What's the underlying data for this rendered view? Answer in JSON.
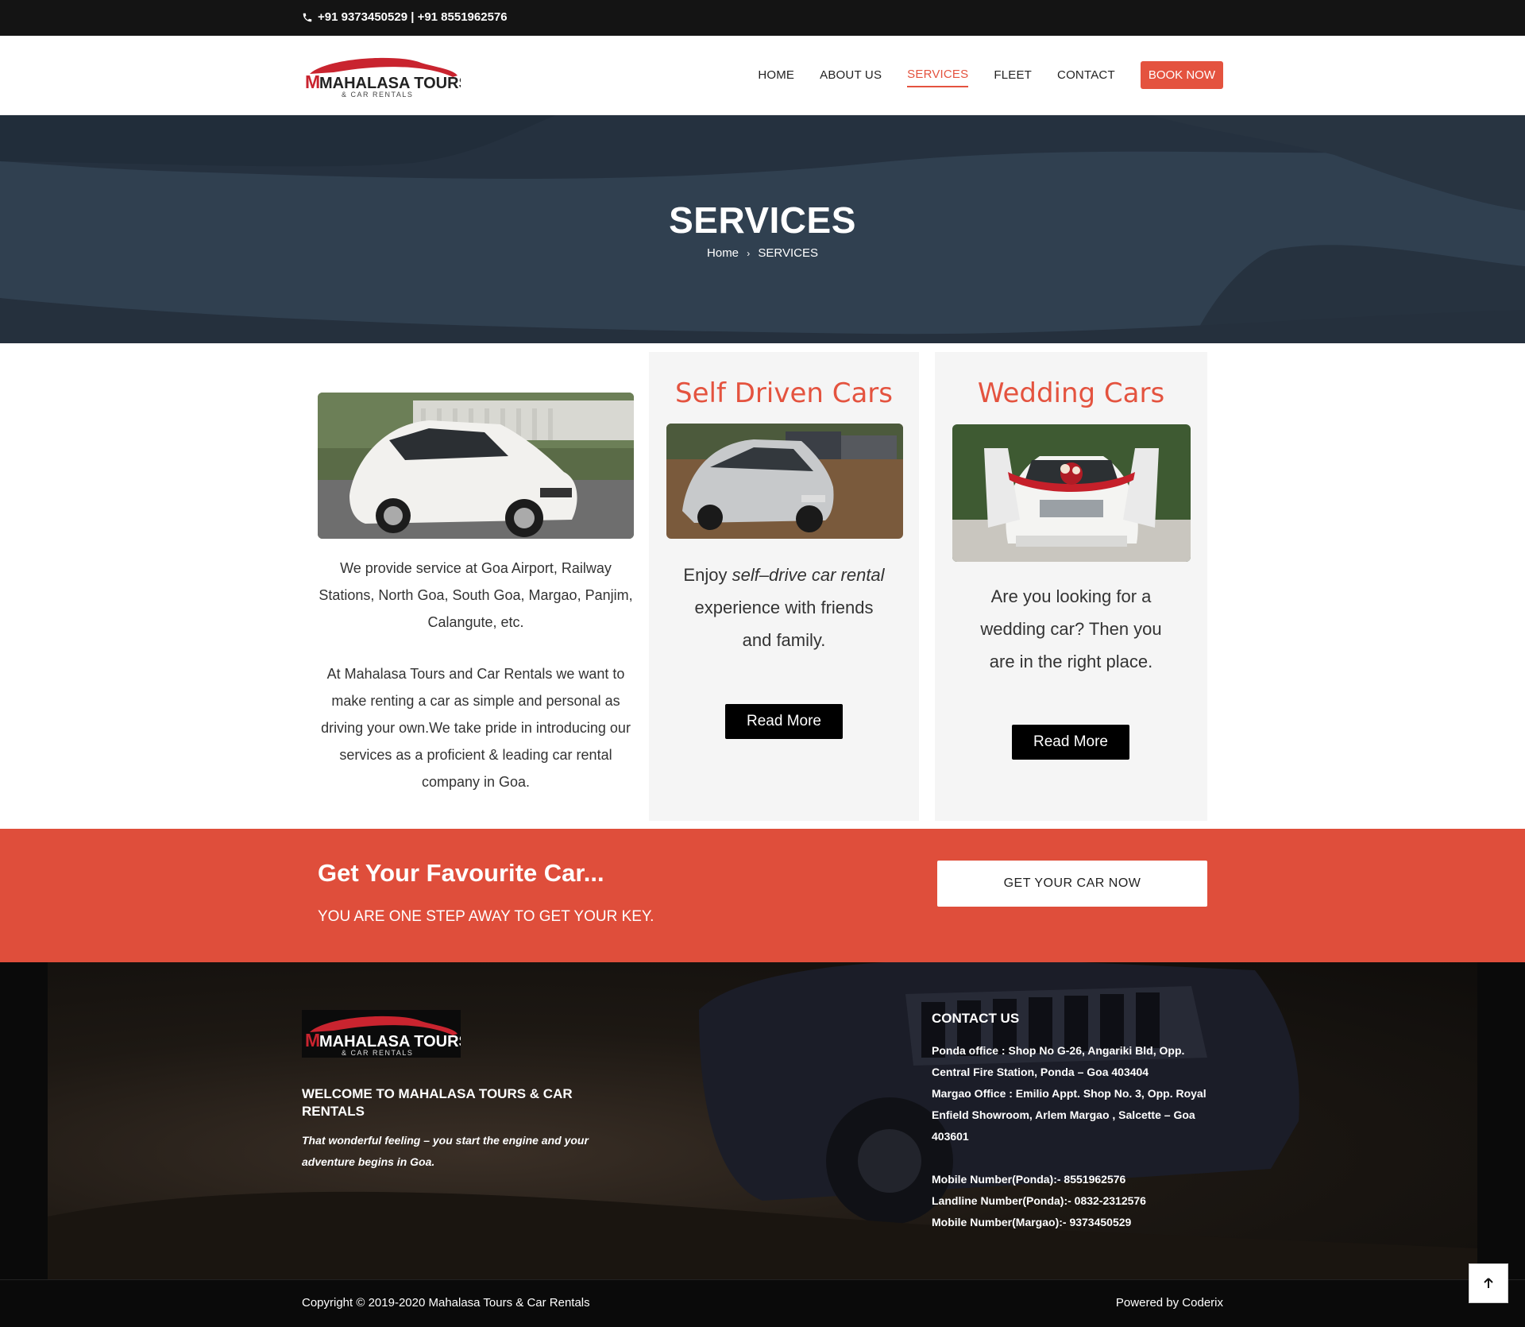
{
  "topbar": {
    "phones": "+91 9373450529 | +91 8551962576"
  },
  "header": {
    "logo_text": "MAHALASA TOURS",
    "logo_sub": "& CAR RENTALS",
    "nav": [
      "HOME",
      "ABOUT US",
      "SERVICES",
      "FLEET",
      "CONTACT"
    ],
    "book": "BOOK NOW"
  },
  "hero": {
    "title": "SERVICES",
    "crumb_home": "Home",
    "crumb_current": "SERVICES"
  },
  "services": {
    "intro_p1": "We provide service at Goa Airport, Railway Stations, North Goa, South Goa, Margao, Panjim, Calangute, etc.",
    "intro_p2": "At Mahalasa Tours and Car Rentals we want to make renting a car as simple and personal as driving your own.We take pride in introducing our services as a proficient & leading car rental company in Goa.",
    "card1_title": "Self Driven Cars",
    "card1_text_a": "Enjoy ",
    "card1_text_b": "self–drive car rental",
    "card1_text_c": " experience with friends and family.",
    "card2_title": "Wedding Cars",
    "card2_text": "Are you looking for a wedding car? Then you are in the right place.",
    "read_more": "Read More"
  },
  "cta": {
    "title": "Get Your Favourite Car...",
    "sub": "YOU ARE ONE STEP AWAY TO GET YOUR KEY.",
    "button": "GET YOUR CAR NOW"
  },
  "footer": {
    "welcome": "WELCOME TO MAHALASA TOURS & CAR RENTALS",
    "tagline": "That wonderful feeling – you start the engine and your adventure begins in Goa.",
    "contact_title": "CONTACT US",
    "ponda": "Ponda office : Shop No G-26, Angariki Bld, Opp. Central Fire Station, Ponda – Goa 403404",
    "margao": "Margao Office : Emilio Appt. Shop No. 3, Opp. Royal Enfield Showroom, Arlem Margao , Salcette – Goa 403601",
    "mobile_ponda": "Mobile Number(Ponda):- 8551962576",
    "landline_ponda": "Landline Number(Ponda):- 0832-2312576",
    "mobile_margao": "Mobile Number(Margao):- 9373450529",
    "copyright": "Copyright © 2019-2020 Mahalasa Tours & Car Rentals",
    "powered": "Powered by Coderix"
  },
  "colors": {
    "accent": "#e4533f",
    "cta_bg": "#df4e3b",
    "topbar": "#141414"
  },
  "icons": [
    "phone-icon",
    "chevron-right-icon",
    "arrow-up-icon"
  ]
}
